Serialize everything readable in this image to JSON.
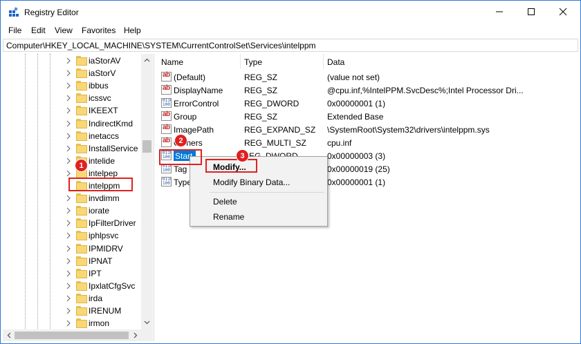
{
  "window": {
    "title": "Registry Editor",
    "controls": {
      "minimize": "minimize",
      "maximize": "maximize",
      "close": "close"
    }
  },
  "menu": [
    "File",
    "Edit",
    "View",
    "Favorites",
    "Help"
  ],
  "address": "Computer\\HKEY_LOCAL_MACHINE\\SYSTEM\\CurrentControlSet\\Services\\intelppm",
  "tree": {
    "items": [
      {
        "label": "iaStorAV",
        "expandable": true
      },
      {
        "label": "iaStorV",
        "expandable": true
      },
      {
        "label": "ibbus",
        "expandable": true
      },
      {
        "label": "icssvc",
        "expandable": true
      },
      {
        "label": "IKEEXT",
        "expandable": true
      },
      {
        "label": "IndirectKmd",
        "expandable": true
      },
      {
        "label": "inetaccs",
        "expandable": true
      },
      {
        "label": "InstallService",
        "expandable": true
      },
      {
        "label": "intelide",
        "expandable": true
      },
      {
        "label": "intelpep",
        "expandable": true
      },
      {
        "label": "intelppm",
        "expandable": false
      },
      {
        "label": "invdimm",
        "expandable": true
      },
      {
        "label": "iorate",
        "expandable": true
      },
      {
        "label": "IpFilterDriver",
        "expandable": true
      },
      {
        "label": "iphlpsvc",
        "expandable": true
      },
      {
        "label": "IPMIDRV",
        "expandable": true
      },
      {
        "label": "IPNAT",
        "expandable": true
      },
      {
        "label": "IPT",
        "expandable": true
      },
      {
        "label": "IpxlatCfgSvc",
        "expandable": true
      },
      {
        "label": "irda",
        "expandable": true
      },
      {
        "label": "IRENUM",
        "expandable": true
      },
      {
        "label": "irmon",
        "expandable": true
      }
    ]
  },
  "list": {
    "columns": {
      "name": "Name",
      "type": "Type",
      "data": "Data"
    },
    "rows": [
      {
        "icon": "string-value-icon",
        "name": "(Default)",
        "type": "REG_SZ",
        "data": "(value not set)"
      },
      {
        "icon": "string-value-icon",
        "name": "DisplayName",
        "type": "REG_SZ",
        "data": "@cpu.inf,%IntelPPM.SvcDesc%;Intel Processor Dri..."
      },
      {
        "icon": "binary-value-icon",
        "name": "ErrorControl",
        "type": "REG_DWORD",
        "data": "0x00000001 (1)"
      },
      {
        "icon": "string-value-icon",
        "name": "Group",
        "type": "REG_SZ",
        "data": "Extended Base"
      },
      {
        "icon": "string-value-icon",
        "name": "ImagePath",
        "type": "REG_EXPAND_SZ",
        "data": "\\SystemRoot\\System32\\drivers\\intelppm.sys"
      },
      {
        "icon": "string-value-icon",
        "name": "Owners",
        "name_visible": "O",
        "name_visible_tail": "ners",
        "type": "REG_MULTI_SZ",
        "data": "cpu.inf"
      },
      {
        "icon": "binary-value-icon",
        "name": "Start",
        "type": "REG_DWORD",
        "type_visible": "EG_DWORD",
        "data": "0x00000003 (3)"
      },
      {
        "icon": "binary-value-icon",
        "name": "Tag",
        "type": "REG_DWORD",
        "data": "0x00000019 (25)"
      },
      {
        "icon": "binary-value-icon",
        "name": "Type",
        "type": "REG_DWORD",
        "data": "0x00000001 (1)"
      }
    ]
  },
  "context_menu": {
    "items": [
      "Modify...",
      "Modify Binary Data...",
      "Delete",
      "Rename"
    ]
  },
  "annotations": [
    "1",
    "2",
    "3"
  ],
  "colors": {
    "highlight": "#0078d7",
    "annotation_red": "#e02020",
    "folder": "#f8d775"
  }
}
